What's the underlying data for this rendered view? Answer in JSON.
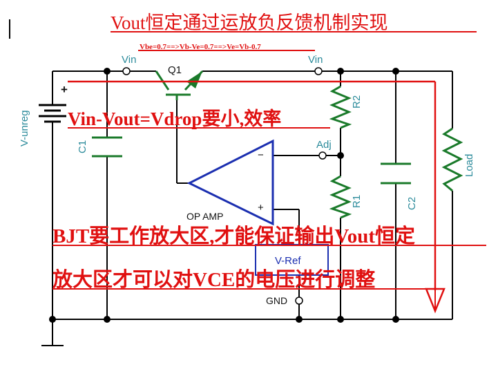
{
  "annotations": {
    "title": "Vout恒定通过运放负反馈机制实现",
    "vbe_equation": "Vbe=0.7==>Vb-Ve=0.7==>Ve=Vb-0.7",
    "vdrop_note": "Vin-Vout=Vdrop要小,效率",
    "bjt_note": "BJT要工作放大区,才能保证输出Vout恒定",
    "vce_note": "放大区才可以对VCE的电压进行调整"
  },
  "labels": {
    "vin_left": "Vin",
    "vin_right": "Vin",
    "q1": "Q1",
    "plus_sign": "+",
    "vunreg": "V-unreg",
    "c1": "C1",
    "r2": "R2",
    "adj": "Adj",
    "minus_input": "−",
    "plus_input": "+",
    "op_amp": "OP AMP",
    "r1": "R1",
    "c2": "C2",
    "load": "Load",
    "vref": "V-Ref",
    "gnd": "GND"
  },
  "colors": {
    "wire": "#000000",
    "component": "#1a7a2a",
    "label": "#2a8a9a",
    "opamp": "#1b2fb0",
    "annotation": "#e01010"
  }
}
